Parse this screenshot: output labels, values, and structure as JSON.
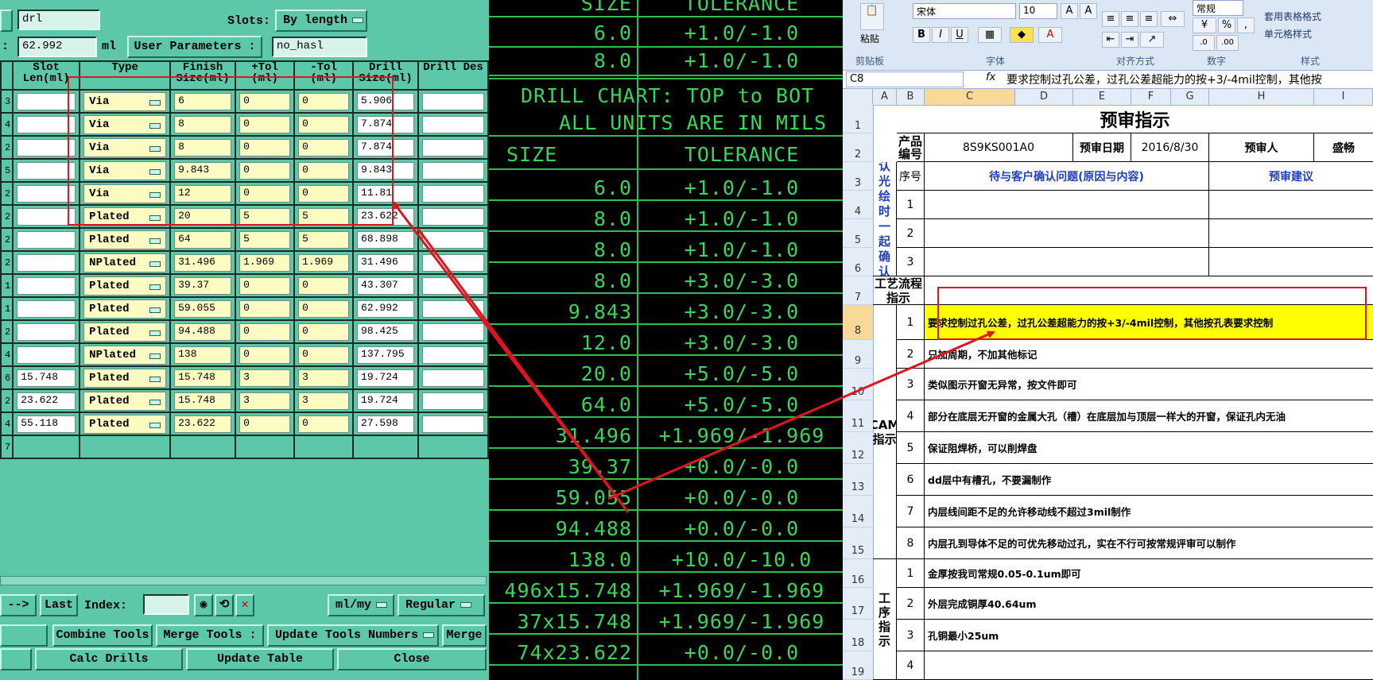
{
  "left_panel": {
    "file_value": "drl",
    "slots_label": "Slots:",
    "slots_value": "By length",
    "field2_prefix": ":",
    "field2_value": "62.992",
    "field2_unit": "ml",
    "user_params_label": "User Parameters :",
    "user_params_value": "no_hasl",
    "columns": [
      "Slot Len(ml)",
      "Type",
      "Finish Size(ml)",
      "+Tol (ml)",
      "-Tol (ml)",
      "Drill Size(ml)",
      "Drill Des"
    ],
    "rows": [
      {
        "idx": "3",
        "slot": "",
        "type": "Via",
        "finish": "6",
        "ptol": "0",
        "mtol": "0",
        "drill": "5.906",
        "des": ""
      },
      {
        "idx": "4",
        "slot": "",
        "type": "Via",
        "finish": "8",
        "ptol": "0",
        "mtol": "0",
        "drill": "7.874",
        "des": ""
      },
      {
        "idx": "2",
        "slot": "",
        "type": "Via",
        "finish": "8",
        "ptol": "0",
        "mtol": "0",
        "drill": "7.874",
        "des": ""
      },
      {
        "idx": "5",
        "slot": "",
        "type": "Via",
        "finish": "9.843",
        "ptol": "0",
        "mtol": "0",
        "drill": "9.843",
        "des": ""
      },
      {
        "idx": "2",
        "slot": "",
        "type": "Via",
        "finish": "12",
        "ptol": "0",
        "mtol": "0",
        "drill": "11.81",
        "des": ""
      },
      {
        "idx": "2",
        "slot": "",
        "type": "Plated",
        "finish": "20",
        "ptol": "5",
        "mtol": "5",
        "drill": "23.622",
        "des": ""
      },
      {
        "idx": "2",
        "slot": "",
        "type": "Plated",
        "finish": "64",
        "ptol": "5",
        "mtol": "5",
        "drill": "68.898",
        "des": ""
      },
      {
        "idx": "2",
        "slot": "",
        "type": "NPlated",
        "finish": "31.496",
        "ptol": "1.969",
        "mtol": "1.969",
        "drill": "31.496",
        "des": ""
      },
      {
        "idx": "1",
        "slot": "",
        "type": "Plated",
        "finish": "39.37",
        "ptol": "0",
        "mtol": "0",
        "drill": "43.307",
        "des": ""
      },
      {
        "idx": "1",
        "slot": "",
        "type": "Plated",
        "finish": "59.055",
        "ptol": "0",
        "mtol": "0",
        "drill": "62.992",
        "des": ""
      },
      {
        "idx": "2",
        "slot": "",
        "type": "Plated",
        "finish": "94.488",
        "ptol": "0",
        "mtol": "0",
        "drill": "98.425",
        "des": ""
      },
      {
        "idx": "4",
        "slot": "",
        "type": "NPlated",
        "finish": "138",
        "ptol": "0",
        "mtol": "0",
        "drill": "137.795",
        "des": ""
      },
      {
        "idx": "6",
        "slot": "15.748",
        "type": "Plated",
        "finish": "15.748",
        "ptol": "3",
        "mtol": "3",
        "drill": "19.724",
        "des": ""
      },
      {
        "idx": "2",
        "slot": "23.622",
        "type": "Plated",
        "finish": "15.748",
        "ptol": "3",
        "mtol": "3",
        "drill": "19.724",
        "des": ""
      },
      {
        "idx": "4",
        "slot": "55.118",
        "type": "Plated",
        "finish": "23.622",
        "ptol": "0",
        "mtol": "0",
        "drill": "27.598",
        "des": ""
      }
    ],
    "empty_row_idx": "7",
    "nav_prev": "-->",
    "nav_last": "Last",
    "index_label": "Index:",
    "index_value": "",
    "units_value": "ml/my",
    "mode_value": "Regular",
    "combine_tools": "Combine Tools",
    "merge_tools": "Merge Tools :",
    "update_tools_numbers": "Update Tools Numbers",
    "merge": "Merge",
    "calc_drills": "Calc Drills",
    "update_table": "Update Table",
    "close": "Close"
  },
  "drill_chart": {
    "top_rows": [
      {
        "size": "SIZE",
        "tol": "TOLERANCE"
      },
      {
        "size": "6.0",
        "tol": "+1.0/-1.0"
      },
      {
        "size": "8.0",
        "tol": "+1.0/-1.0"
      }
    ],
    "title1": "DRILL CHART: TOP to BOT",
    "title2": "ALL UNITS ARE IN MILS",
    "header": {
      "size": "SIZE",
      "tol": "TOLERANCE"
    },
    "rows": [
      {
        "size": "6.0",
        "tol": "+1.0/-1.0"
      },
      {
        "size": "8.0",
        "tol": "+1.0/-1.0"
      },
      {
        "size": "8.0",
        "tol": "+1.0/-1.0"
      },
      {
        "size": "8.0",
        "tol": "+3.0/-3.0"
      },
      {
        "size": "9.843",
        "tol": "+3.0/-3.0"
      },
      {
        "size": "12.0",
        "tol": "+3.0/-3.0"
      },
      {
        "size": "20.0",
        "tol": "+5.0/-5.0"
      },
      {
        "size": "64.0",
        "tol": "+5.0/-5.0"
      },
      {
        "size": "31.496",
        "tol": "+1.969/-1.969"
      },
      {
        "size": "39.37",
        "tol": "+0.0/-0.0"
      },
      {
        "size": "59.055",
        "tol": "+0.0/-0.0"
      },
      {
        "size": "94.488",
        "tol": "+0.0/-0.0"
      },
      {
        "size": "138.0",
        "tol": "+10.0/-10.0"
      },
      {
        "size": "496x15.748",
        "tol": "+1.969/-1.969"
      },
      {
        "size": "37x15.748",
        "tol": "+1.969/-1.969"
      },
      {
        "size": "74x23.622",
        "tol": "+0.0/-0.0"
      }
    ]
  },
  "excel": {
    "ribbon": {
      "font_name": "宋体",
      "font_size": "10",
      "paste_label": "粘贴",
      "number_format": "常规",
      "conditional_format": "套用表格格式",
      "cell_styles": "单元格样式",
      "groups": [
        "剪贴板",
        "字体",
        "对齐方式",
        "数字",
        "样式"
      ]
    },
    "name_box": "C8",
    "fx": "fx",
    "formula": "要求控制过孔公差，过孔公差超能力的按+3/-4mil控制，其他按",
    "columns": [
      "A",
      "B",
      "C",
      "D",
      "E",
      "F",
      "G",
      "H",
      "I"
    ],
    "rows": [
      "1",
      "2",
      "3",
      "4",
      "5",
      "6",
      "7",
      "8",
      "9",
      "10",
      "11",
      "12",
      "13",
      "14",
      "15",
      "16",
      "17",
      "18",
      "19"
    ],
    "title": "预审指示",
    "product_label": "产品编号",
    "product_value": "8S9KS001A0",
    "review_date_label": "预审日期",
    "review_date_value": "2016/8/30",
    "reviewer_label": "预审人",
    "reviewer_value": "盛畅",
    "confirm_label": "待确认光绘时一起确认问题",
    "seq_label": "序号",
    "question_header": "待与客户确认问题(原因与内容)",
    "suggestion_header": "预审建议",
    "confirm_items": [
      "1",
      "2",
      "3"
    ],
    "process_label": "工艺流程指示",
    "cam_label": "CAM指示",
    "cam_items": [
      {
        "no": "1",
        "text": "要求控制过孔公差，过孔公差超能力的按+3/-4mil控制，其他按孔表要求控制"
      },
      {
        "no": "2",
        "text": "只加周期，不加其他标记"
      },
      {
        "no": "3",
        "text": "类似图示开窗无异常，按文件即可"
      },
      {
        "no": "4",
        "text": "部分在底层无开窗的金属大孔（槽）在底层加与顶层一样大的开窗，保证孔内无油"
      },
      {
        "no": "5",
        "text": "保证阻焊桥，可以削焊盘"
      },
      {
        "no": "6",
        "text": "dd层中有槽孔，不要漏制作"
      },
      {
        "no": "7",
        "text": "内层线间距不足的允许移动线不超过3mil制作"
      },
      {
        "no": "8",
        "text": "内层孔到导体不足的可优先移动过孔，实在不行可按常规评审可以制作"
      }
    ],
    "process2_label": "工序指示",
    "process_items": [
      {
        "no": "1",
        "text": "金厚按我司常规0.05-0.1um即可"
      },
      {
        "no": "2",
        "text": "外层完成铜厚40.64um"
      },
      {
        "no": "3",
        "text": "孔铜最小25um"
      },
      {
        "no": "4",
        "text": ""
      }
    ]
  },
  "colors": {
    "panel_green": "#5dc7a9",
    "cell_yellow": "#fbfbc2",
    "chart_green": "#36d65a",
    "annotation_red": "#e0141e",
    "highlight_yellow": "#ffff00"
  }
}
